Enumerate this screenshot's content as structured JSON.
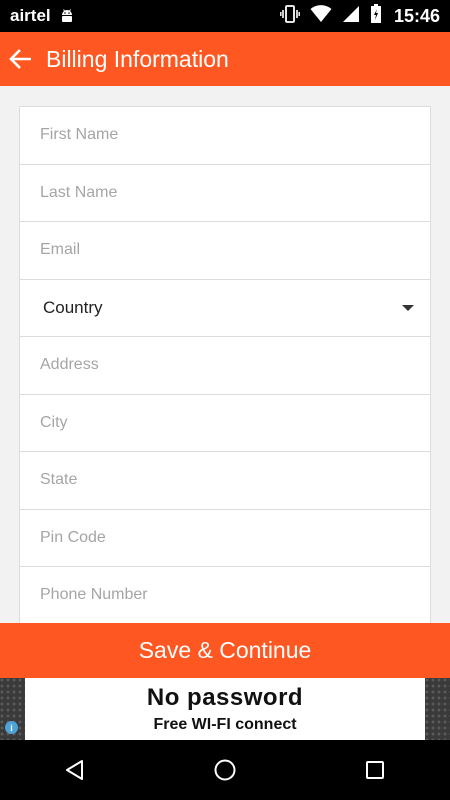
{
  "status_bar": {
    "carrier": "airtel",
    "time": "15:46",
    "icons": [
      "android-icon",
      "vibrate-icon",
      "wifi-icon",
      "signal-icon",
      "battery-icon"
    ]
  },
  "app_bar": {
    "title": "Billing Information",
    "back_icon": "arrow-left-icon"
  },
  "form": {
    "fields": [
      {
        "placeholder": "First Name"
      },
      {
        "placeholder": "Last Name"
      },
      {
        "placeholder": "Email"
      },
      {
        "value": "Country",
        "type": "dropdown"
      },
      {
        "placeholder": "Address"
      },
      {
        "placeholder": "City"
      },
      {
        "placeholder": "State"
      },
      {
        "placeholder": "Pin Code"
      },
      {
        "placeholder": "Phone Number"
      }
    ]
  },
  "save_button": {
    "label": "Save & Continue"
  },
  "ad": {
    "headline": "No password",
    "subline": "Free WI-FI connect",
    "info_label": "i"
  },
  "nav_bar": {
    "icons": [
      "back-triangle-icon",
      "home-circle-icon",
      "recents-square-icon"
    ]
  },
  "colors": {
    "accent": "#ff5722",
    "status_bar": "#000000",
    "field_border": "#dcdcdc"
  }
}
